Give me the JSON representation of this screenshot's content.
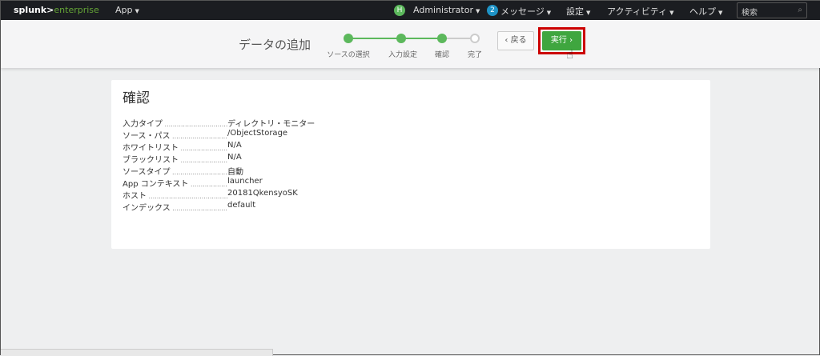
{
  "nav": {
    "logo_a": "splunk>",
    "logo_b": "enterprise",
    "app": "App",
    "avatar": "H",
    "user": "Administrator",
    "msg_count": "2",
    "messages": "メッセージ",
    "settings": "設定",
    "activity": "アクティビティ",
    "help": "ヘルプ",
    "search_placeholder": "検索"
  },
  "header": {
    "title": "データの追加",
    "steps": [
      "ソースの選択",
      "入力設定",
      "確認",
      "完了"
    ],
    "back": "‹ 戻る",
    "run": "実行 ›"
  },
  "card": {
    "title": "確認",
    "rows": [
      {
        "k": "入力タイプ",
        "v": "ディレクトリ・モニター"
      },
      {
        "k": "ソース・パス",
        "v": "/ObjectStorage"
      },
      {
        "k": "ホワイトリスト",
        "v": "N/A"
      },
      {
        "k": "ブラックリスト",
        "v": "N/A"
      },
      {
        "k": "ソースタイプ",
        "v": "自動"
      },
      {
        "k": "App コンテキスト",
        "v": "launcher"
      },
      {
        "k": "ホスト",
        "v": "20181QkensyoSK"
      },
      {
        "k": "インデックス",
        "v": "default"
      }
    ]
  }
}
